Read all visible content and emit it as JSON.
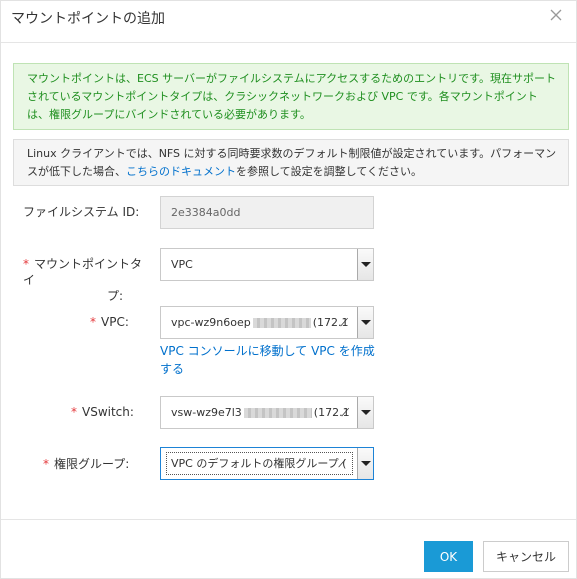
{
  "dialog": {
    "title": "マウントポイントの追加",
    "close_icon": "close-icon"
  },
  "notices": {
    "info": "マウントポイントは、ECS サーバーがファイルシステムにアクセスするためのエントリです。現在サポートされているマウントポイントタイプは、クラシックネットワークおよび VPC です。各マウントポイントは、権限グループにバインドされている必要があります。",
    "linux_prefix": "Linux クライアントでは、NFS に対する同時要求数のデフォルト制限値が設定されています。パフォーマンスが低下した場合、",
    "linux_link": "こちらのドキュメント",
    "linux_suffix": "を参照して設定を調整してください。"
  },
  "form": {
    "filesystem_id": {
      "label": "ファイルシステム ID:",
      "value": "2e3384a0dd"
    },
    "mount_type": {
      "required": "*",
      "label_line1": "マウントポイントタイ",
      "label_line2": "プ:",
      "value": "VPC"
    },
    "vpc": {
      "required": "*",
      "label": "VPC:",
      "value_prefix": "vpc-wz9n6oep",
      "value_suffix": "(172.1̸"
    },
    "vpc_link": "VPC コンソールに移動して VPC を作成する",
    "vswitch": {
      "required": "*",
      "label": "VSwitch:",
      "value_prefix": "vsw-wz9e7l3",
      "value_suffix": "(172.1̸"
    },
    "permission_group": {
      "required": "*",
      "label": "権限グループ:",
      "value": "VPC のデフォルトの権限グループ (̸"
    }
  },
  "footer": {
    "ok_label": "OK",
    "cancel_label": "キャンセル"
  },
  "colors": {
    "accent": "#1a9ad6",
    "link": "#0070cc",
    "required": "#e4393c",
    "success_text": "#1f8f1f",
    "success_bg": "#e9f7e4"
  }
}
